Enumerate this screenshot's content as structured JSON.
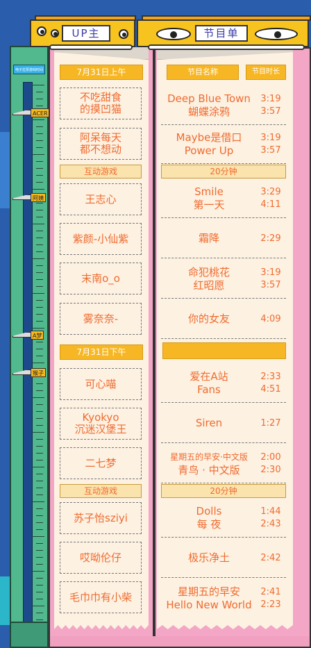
{
  "colors": {
    "background": "#2a5dab",
    "accent": "#f7b725",
    "text": "#ef6b2f",
    "panel": "#f3a6c6",
    "ruler": "#52b98f"
  },
  "ruler": {
    "title": "电子拉票游戏时间",
    "markers": [
      "ACER",
      "阿姨",
      "A梦",
      "猴子"
    ]
  },
  "header": {
    "left_label": "UP主",
    "right_label": "节目单"
  },
  "left_column": {
    "date_morning": "7月31日上午",
    "date_afternoon": "7月31日下午",
    "game_label": "互动游戏",
    "morning_ups": [
      [
        "不吃甜食",
        "的摸凹猫"
      ],
      [
        "阿呆每天",
        "都不想动"
      ]
    ],
    "morning_ups_after_game": [
      [
        "王志心"
      ],
      [
        "紫颜-小仙紫"
      ],
      [
        "末南o_o"
      ],
      [
        "雾奈奈-"
      ]
    ],
    "afternoon_ups": [
      [
        "可心喵"
      ],
      [
        "Kyokyo",
        "沉迷汉堡王"
      ],
      [
        "二七梦"
      ]
    ],
    "afternoon_ups_after_game": [
      [
        "苏子怡sziyi"
      ],
      [
        "哎呦伦仔"
      ],
      [
        "毛巾巾有小柴"
      ]
    ]
  },
  "right_column": {
    "col_name": "节目名称",
    "col_duration": "节目时长",
    "section_20min": "20分钟",
    "rows_a": [
      {
        "names": [
          "Deep Blue Town",
          "蝴蝶涂鸦"
        ],
        "times": [
          "3:19",
          "3:57"
        ]
      },
      {
        "names": [
          "Maybe是借口",
          "Power Up"
        ],
        "times": [
          "3:19",
          "3:57"
        ]
      }
    ],
    "rows_b": [
      {
        "names": [
          "Smile",
          "第一天"
        ],
        "times": [
          "3:29",
          "4:11"
        ]
      },
      {
        "names": [
          "霜降"
        ],
        "times": [
          "2:29"
        ]
      },
      {
        "names": [
          "命犯桃花",
          "红昭愿"
        ],
        "times": [
          "3:19",
          "3:57"
        ]
      },
      {
        "names": [
          "你的女友"
        ],
        "times": [
          "4:09"
        ]
      }
    ],
    "rows_c": [
      {
        "names": [
          "爱在A站",
          "Fans"
        ],
        "times": [
          "2:33",
          "4:51"
        ]
      },
      {
        "names": [
          "Siren"
        ],
        "times": [
          "1:27"
        ]
      },
      {
        "names": [
          "星期五的早安·中文版",
          "青鸟 · 中文版"
        ],
        "times": [
          "2:00",
          "2:30"
        ]
      }
    ],
    "rows_d": [
      {
        "names": [
          "Dolls",
          "每 夜"
        ],
        "times": [
          "1:44",
          "2:43"
        ]
      },
      {
        "names": [
          "极乐净土"
        ],
        "times": [
          "2:42"
        ]
      },
      {
        "names": [
          "星期五的早安",
          "Hello New World"
        ],
        "times": [
          "2:41",
          "2:23"
        ]
      }
    ]
  }
}
